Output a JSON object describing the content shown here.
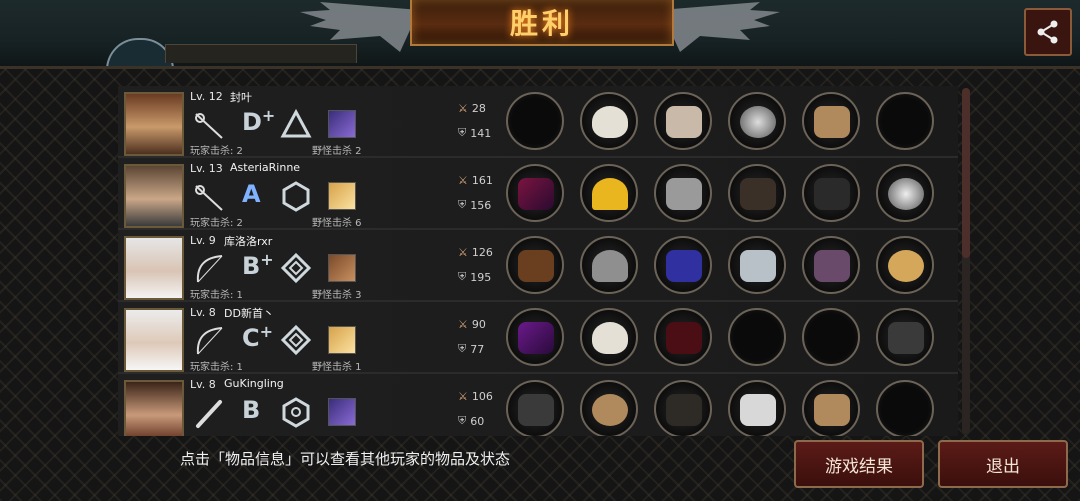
{
  "header": {
    "title": "胜利"
  },
  "top_icons": {
    "share": "share-icon"
  },
  "colors": {
    "title_glow": "#ff8a1f",
    "title_text": "#ffcf6a",
    "button_bg": "#5b1b17",
    "button_border": "#8d6a4b"
  },
  "players": [
    {
      "level": "Lv. 12",
      "name": "封叶",
      "weapon": "rapier-icon",
      "rank": "D",
      "rank_plus": "+",
      "emblem": "triangle-emblem-icon",
      "player_kills": "玩家击杀: 2",
      "monster_kills": "野怪击杀 2",
      "attack": "28",
      "defense": "141",
      "items": [
        "empty",
        "mask",
        "helmet",
        "plate",
        "sandals",
        "empty"
      ]
    },
    {
      "level": "Lv. 13",
      "name": "AsteriaRinne",
      "weapon": "rapier-icon",
      "rank": "A",
      "rank_plus": "",
      "emblem": "hexagon-emblem-icon",
      "player_kills": "玩家击杀: 2",
      "monster_kills": "野怪击杀 6",
      "attack": "161",
      "defense": "156",
      "items": [
        "blade",
        "hardhat",
        "armor",
        "gauntlet",
        "boots",
        "orb"
      ]
    },
    {
      "level": "Lv. 9",
      "name": "库洛洛rxr",
      "weapon": "bow-icon",
      "rank": "B",
      "rank_plus": "+",
      "emblem": "diamond-emblem-icon",
      "player_kills": "玩家击杀: 1",
      "monster_kills": "野怪击杀 3",
      "attack": "126",
      "defense": "195",
      "items": [
        "crossbow",
        "knight-helm",
        "robe",
        "bracer",
        "greaves",
        "fan"
      ]
    },
    {
      "level": "Lv. 8",
      "name": "DD新首丶",
      "weapon": "bow-icon",
      "rank": "C",
      "rank_plus": "+",
      "emblem": "diamond-emblem-icon",
      "player_kills": "玩家击杀: 1",
      "monster_kills": "野怪击杀 1",
      "attack": "90",
      "defense": "77",
      "items": [
        "bow",
        "mask",
        "cloak",
        "empty",
        "empty",
        "quiver"
      ]
    },
    {
      "level": "Lv. 8",
      "name": "GuKingling",
      "weapon": "bat-icon",
      "rank": "B",
      "rank_plus": "",
      "emblem": "hexagon-emblem-icon",
      "player_kills": "",
      "monster_kills": "",
      "attack": "106",
      "defense": "60",
      "items": [
        "nunchaku",
        "bandage",
        "coat",
        "chain",
        "sandals",
        "empty"
      ]
    }
  ],
  "footer": {
    "hint": "点击「物品信息」可以查看其他玩家的物品及状态",
    "result_button": "游戏结果",
    "exit_button": "退出"
  }
}
